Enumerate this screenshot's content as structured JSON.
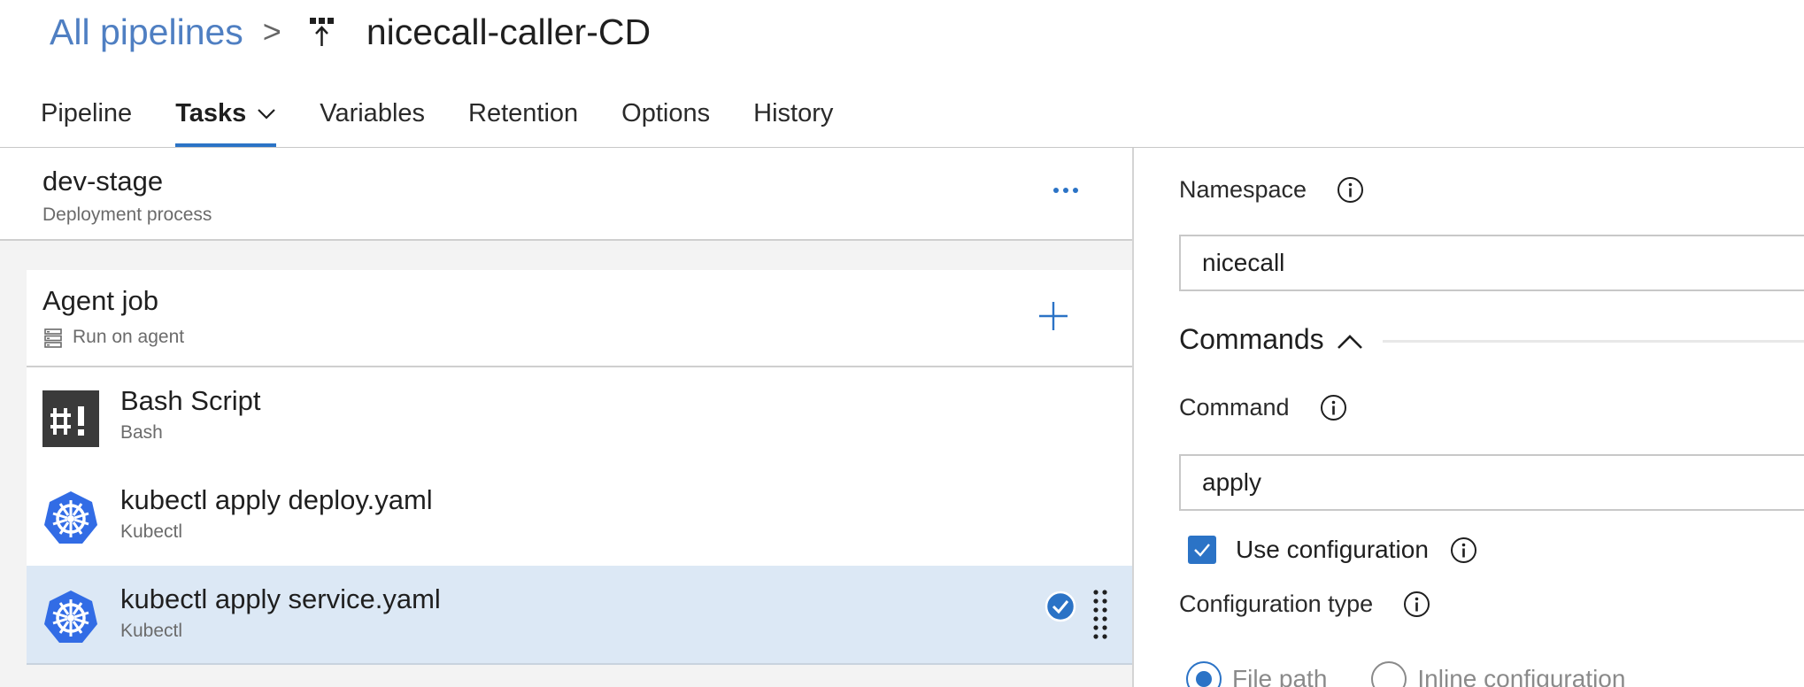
{
  "breadcrumb": {
    "root_label": "All pipelines",
    "separator": ">",
    "pipeline_name": "nicecall-caller-CD"
  },
  "tabs": [
    {
      "label": "Pipeline"
    },
    {
      "label": "Tasks"
    },
    {
      "label": "Variables"
    },
    {
      "label": "Retention"
    },
    {
      "label": "Options"
    },
    {
      "label": "History"
    }
  ],
  "active_tab": "Tasks",
  "stage": {
    "name": "dev-stage",
    "subtitle": "Deployment process"
  },
  "agent_job": {
    "name": "Agent job",
    "subtitle": "Run on agent"
  },
  "tasks": [
    {
      "name": "Bash Script",
      "type": "Bash",
      "icon": "bash-icon"
    },
    {
      "name": "kubectl apply deploy.yaml",
      "type": "Kubectl",
      "icon": "kubernetes-icon"
    },
    {
      "name": "kubectl apply service.yaml",
      "type": "Kubectl",
      "icon": "kubernetes-icon",
      "selected": true
    }
  ],
  "settings": {
    "namespace": {
      "label": "Namespace",
      "value": "nicecall"
    },
    "commands_section": {
      "title": "Commands",
      "expanded": true
    },
    "command": {
      "label": "Command",
      "value": "apply"
    },
    "use_configuration": {
      "label": "Use configuration",
      "checked": true
    },
    "configuration_type": {
      "label": "Configuration type",
      "options": [
        {
          "label": "File path",
          "selected": true
        },
        {
          "label": "Inline configuration",
          "selected": false
        }
      ]
    }
  },
  "colors": {
    "accent": "#2b73c6",
    "selected_row": "#dce8f5",
    "kubernetes_blue": "#326ce5",
    "bash_dark": "#3a3a3a"
  }
}
